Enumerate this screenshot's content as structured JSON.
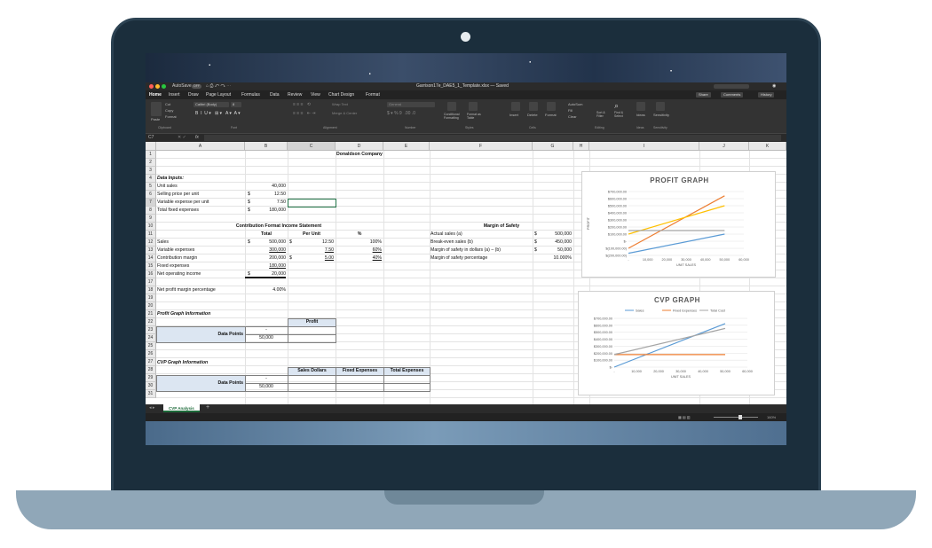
{
  "window": {
    "file_title": "Garrison17e_DAE5_1_Template.xlsx — Saved",
    "autosave": "AutoSave",
    "autosave_state": "OFF"
  },
  "ribbon_tabs": [
    "Home",
    "Insert",
    "Draw",
    "Page Layout",
    "Formulas",
    "Data",
    "Review",
    "View",
    "Chart Design",
    "Format"
  ],
  "ribbon_buttons": {
    "share": "Share",
    "comments": "Comments",
    "history": "History"
  },
  "ribbon": {
    "cut": "Cut",
    "copy": "Copy",
    "format": "Format",
    "paste": "Paste",
    "font_name": "Calibri (Body)",
    "font_size": "8",
    "wrap_text": "Wrap Text",
    "merge": "Merge & Center",
    "number_format": "General",
    "cond_format": "Conditional Formatting",
    "format_table": "Format as Table",
    "insert": "Insert",
    "delete": "Delete",
    "format_cells": "Format",
    "autosum": "AutoSum",
    "fill": "Fill",
    "clear": "Clear",
    "sort_filter": "Sort & Filter",
    "find_select": "Find & Select",
    "ideas": "Ideas",
    "sensitivity": "Sensitivity",
    "groups": {
      "clipboard": "Clipboard",
      "font": "Font",
      "alignment": "Alignment",
      "number": "Number",
      "styles": "Styles",
      "cells": "Cells",
      "editing": "Editing",
      "ideas": "Ideas",
      "sensitivity": "Sensitivity"
    }
  },
  "formula_bar": {
    "cell_ref": "C7",
    "fx": "fx"
  },
  "columns": [
    "A",
    "B",
    "C",
    "D",
    "E",
    "F",
    "G",
    "H",
    "I",
    "J",
    "K"
  ],
  "rows": [
    "1",
    "2",
    "3",
    "4",
    "5",
    "6",
    "7",
    "8",
    "9",
    "10",
    "11",
    "12",
    "13",
    "14",
    "15",
    "16",
    "17",
    "18",
    "19",
    "20",
    "21",
    "22",
    "23",
    "24",
    "25",
    "26",
    "27",
    "28",
    "29",
    "30",
    "31"
  ],
  "sheet": {
    "company": "Donaldson Company",
    "data_inputs": "Data Inputs:",
    "unit_sales_label": "Unit sales",
    "unit_sales": "40,000",
    "price_label": "Selling price per unit",
    "price": "12.50",
    "var_exp_label": "Variable expense per unit",
    "var_exp": "7.50",
    "fixed_label": "Total fixed expenses",
    "fixed": "180,000",
    "dollar": "$",
    "income_title": "Contribution Format Income Statement",
    "total_h": "Total",
    "perunit_h": "Per Unit",
    "pct_h": "%",
    "sales_label": "Sales",
    "sales_total": "500,000",
    "sales_unit": "12.50",
    "sales_pct": "100%",
    "varexp_label": "Variable expenses",
    "varexp_total": "300,000",
    "varexp_unit": "7.50",
    "varexp_pct": "60%",
    "cm_label": "Contribution margin",
    "cm_total": "200,000",
    "cm_unit": "5.00",
    "cm_pct": "40%",
    "fixedexp_label": "Fixed expenses",
    "fixedexp_total": "180,000",
    "noi_label": "Net operating income",
    "noi_total": "20,000",
    "npm_label": "Net profit margin percentage",
    "npm": "4.00%",
    "mos_title": "Margin of Safety",
    "actual_label": "Actual sales (a)",
    "actual": "500,000",
    "be_label": "Break-even sales (b)",
    "be": "450,000",
    "mos_label": "Margin of safety in dollars (a) – (b)",
    "mos": "50,000",
    "mosp_label": "Margin of safety percentage",
    "mosp": "10.000%",
    "profit_info": "Profit Graph Information",
    "profit_h": "Profit",
    "data_points": "Data Points",
    "dash": "-",
    "dp_50000": "50,000",
    "cvp_info": "CVP Graph Information",
    "sales_dollars_h": "Sales Dollars",
    "fixed_exp_h": "Fixed Expenses",
    "total_exp_h": "Total Expenses"
  },
  "sheet_tab": "CVP Analysis",
  "zoom": "160%",
  "chart_data": [
    {
      "type": "line",
      "title": "PROFIT GRAPH",
      "xlabel": "UNIT SALES",
      "ylabel": "PROFIT",
      "x_ticks": [
        "-",
        "10,000",
        "20,000",
        "30,000",
        "40,000",
        "50,000",
        "60,000"
      ],
      "y_ticks": [
        "$700,000.00",
        "$600,000.00",
        "$500,000.00",
        "$400,000.00",
        "$300,000.00",
        "$200,000.00",
        "$100,000.00",
        "$-",
        "$(100,000.00)",
        "$(200,000.00)"
      ],
      "ylim": [
        -200000,
        700000
      ],
      "xlim": [
        0,
        60000
      ],
      "series": [
        {
          "color": "#ed7d31",
          "x": [
            0,
            50000
          ],
          "y": [
            -100000,
            640000
          ]
        },
        {
          "color": "#ffc000",
          "x": [
            0,
            50000
          ],
          "y": [
            100000,
            500000
          ]
        },
        {
          "color": "#a5a5a5",
          "x": [
            0,
            50000
          ],
          "y": [
            150000,
            150000
          ]
        },
        {
          "color": "#5b9bd5",
          "x": [
            0,
            50000
          ],
          "y": [
            -170000,
            100000
          ]
        }
      ]
    },
    {
      "type": "line",
      "title": "CVP GRAPH",
      "xlabel": "UNIT SALES",
      "x_ticks": [
        "-",
        "10,000",
        "20,000",
        "30,000",
        "40,000",
        "50,000",
        "60,000"
      ],
      "y_ticks": [
        "$700,000.00",
        "$600,000.00",
        "$500,000.00",
        "$400,000.00",
        "$300,000.00",
        "$200,000.00",
        "$100,000.00",
        "$-"
      ],
      "ylim": [
        0,
        700000
      ],
      "xlim": [
        0,
        60000
      ],
      "legend": "top",
      "series": [
        {
          "name": "Sales",
          "color": "#5b9bd5",
          "x": [
            0,
            50000
          ],
          "y": [
            0,
            625000
          ]
        },
        {
          "name": "Fixed Expenses",
          "color": "#ed7d31",
          "x": [
            0,
            50000
          ],
          "y": [
            180000,
            180000
          ]
        },
        {
          "name": "Total Cost",
          "color": "#a5a5a5",
          "x": [
            0,
            50000
          ],
          "y": [
            180000,
            555000
          ]
        }
      ]
    }
  ]
}
